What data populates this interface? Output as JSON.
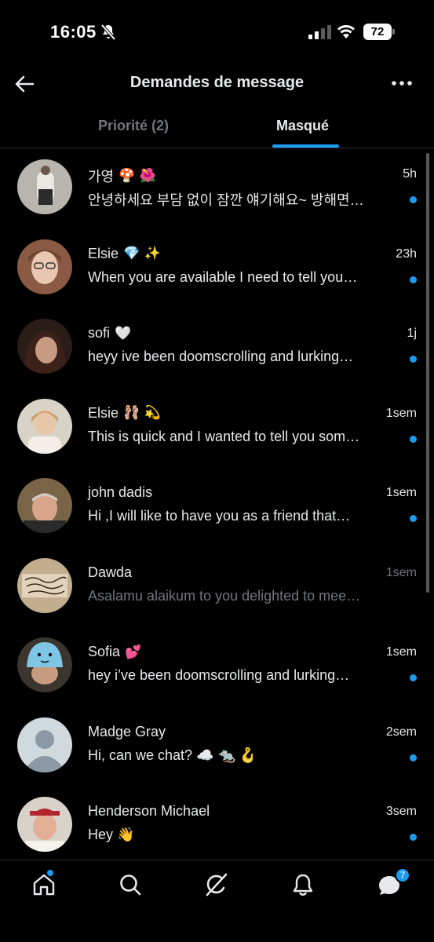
{
  "status_bar": {
    "time": "16:05",
    "battery": "72"
  },
  "header": {
    "title": "Demandes de message"
  },
  "tabs": [
    {
      "label": "Priorité (2)",
      "active": false
    },
    {
      "label": "Masqué",
      "active": true
    }
  ],
  "messages": [
    {
      "name": "가영",
      "emoji": "🍄 🌺",
      "time": "5h",
      "preview": "안녕하세요 부담 없이 잠깐 얘기해요~ 방해면…",
      "unread": true
    },
    {
      "name": "Elsie",
      "emoji": "💎 ✨",
      "time": "23h",
      "preview": "When you are available I need to tell you…",
      "unread": true
    },
    {
      "name": "sofi",
      "emoji": "🤍",
      "time": "1j",
      "preview": "heyy ive been doomscrolling and lurking…",
      "unread": true
    },
    {
      "name": "Elsie",
      "emoji": "🩰 💫",
      "time": "1sem",
      "preview": "This is quick and I wanted to tell you som…",
      "unread": true
    },
    {
      "name": "john dadis",
      "emoji": "",
      "time": "1sem",
      "preview": "Hi ,I will like to have you as a friend that…",
      "unread": true
    },
    {
      "name": "Dawda",
      "emoji": "",
      "time": "1sem",
      "preview": "Asalamu alaikum to you delighted to mee…",
      "unread": false
    },
    {
      "name": "Sofia",
      "emoji": "💕",
      "time": "1sem",
      "preview": "hey i’ve been doomscrolling and lurking…",
      "unread": true
    },
    {
      "name": "Madge Gray",
      "emoji": "",
      "time": "2sem",
      "preview": "Hi, can we chat? ☁️ 🐀 🪝",
      "unread": true
    },
    {
      "name": "Henderson Michael",
      "emoji": "",
      "time": "3sem",
      "preview": "Hey 👋",
      "unread": true
    }
  ],
  "bottom_nav": {
    "messages_badge": "7"
  },
  "colors": {
    "accent": "#1d9bf0",
    "muted_text": "#71767b",
    "background": "#000000"
  }
}
